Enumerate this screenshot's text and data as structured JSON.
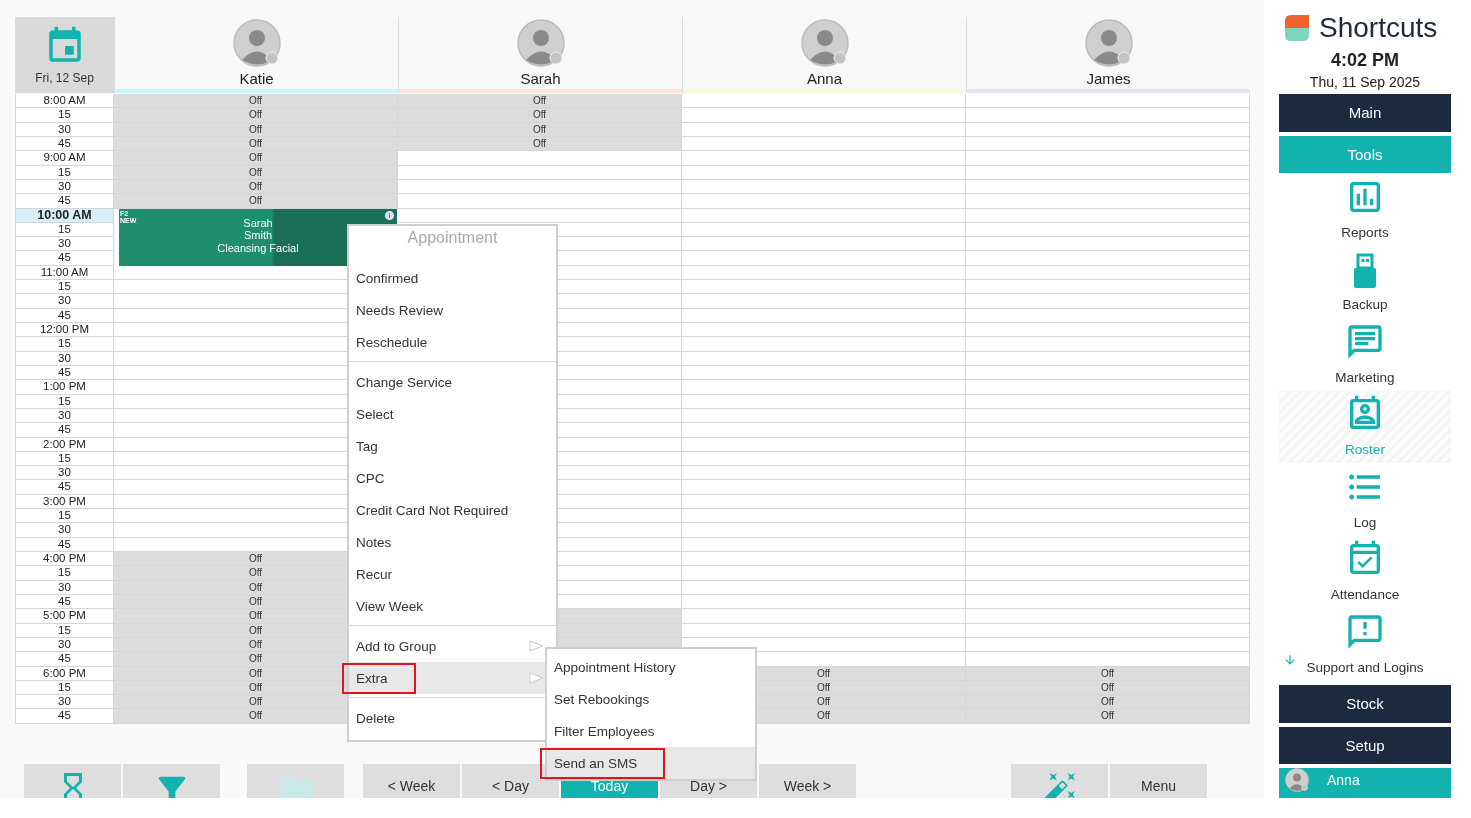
{
  "date_button": {
    "label": "Fri, 12 Sep"
  },
  "staff": [
    {
      "name": "Katie",
      "color": "#c4f6f6"
    },
    {
      "name": "Sarah",
      "color": "#fbe1dc"
    },
    {
      "name": "Anna",
      "color": "#fafad4"
    },
    {
      "name": "James",
      "color": "#e3e3f6"
    }
  ],
  "rows": [
    {
      "time": "8:00 AM",
      "selected": false,
      "cells": [
        {
          "off": true,
          "label": "Off"
        },
        {
          "off": true,
          "label": "Off"
        },
        {
          "off": false
        },
        {
          "off": false
        }
      ]
    },
    {
      "time": "15",
      "selected": false,
      "cells": [
        {
          "off": true,
          "label": "Off"
        },
        {
          "off": true,
          "label": "Off"
        },
        {
          "off": false
        },
        {
          "off": false
        }
      ]
    },
    {
      "time": "30",
      "selected": false,
      "cells": [
        {
          "off": true,
          "label": "Off"
        },
        {
          "off": true,
          "label": "Off"
        },
        {
          "off": false
        },
        {
          "off": false
        }
      ]
    },
    {
      "time": "45",
      "selected": false,
      "cells": [
        {
          "off": true,
          "label": "Off"
        },
        {
          "off": true,
          "label": "Off"
        },
        {
          "off": false
        },
        {
          "off": false
        }
      ]
    },
    {
      "time": "9:00 AM",
      "selected": false,
      "cells": [
        {
          "off": true,
          "label": "Off"
        },
        {
          "off": false
        },
        {
          "off": false
        },
        {
          "off": false
        }
      ]
    },
    {
      "time": "15",
      "selected": false,
      "cells": [
        {
          "off": true,
          "label": "Off"
        },
        {
          "off": false
        },
        {
          "off": false
        },
        {
          "off": false
        }
      ]
    },
    {
      "time": "30",
      "selected": false,
      "cells": [
        {
          "off": true,
          "label": "Off"
        },
        {
          "off": false
        },
        {
          "off": false
        },
        {
          "off": false
        }
      ]
    },
    {
      "time": "45",
      "selected": false,
      "cells": [
        {
          "off": true,
          "label": "Off"
        },
        {
          "off": false
        },
        {
          "off": false
        },
        {
          "off": false
        }
      ]
    },
    {
      "time": "10:00 AM",
      "selected": true,
      "cells": [
        {
          "booked": true,
          "appointment": {
            "tag": "F2",
            "badge": "NEW",
            "lines": [
              "Sarah",
              "Smith",
              "Cleansing Facial"
            ]
          }
        },
        {
          "off": false
        },
        {
          "off": false
        },
        {
          "off": false
        }
      ]
    },
    {
      "time": "15",
      "selected": false,
      "cells": [
        {
          "booked": true
        },
        {
          "off": false
        },
        {
          "off": false
        },
        {
          "off": false
        }
      ]
    },
    {
      "time": "30",
      "selected": false,
      "cells": [
        {
          "booked": true
        },
        {
          "off": false
        },
        {
          "off": false
        },
        {
          "off": false
        }
      ]
    },
    {
      "time": "45",
      "selected": false,
      "cells": [
        {
          "booked": true
        },
        {
          "off": false
        },
        {
          "off": false
        },
        {
          "off": false
        }
      ]
    },
    {
      "time": "11:00 AM",
      "selected": false,
      "cells": [
        {
          "off": false
        },
        {
          "off": false
        },
        {
          "off": false
        },
        {
          "off": false
        }
      ]
    },
    {
      "time": "15",
      "selected": false,
      "cells": [
        {
          "off": false
        },
        {
          "off": false
        },
        {
          "off": false
        },
        {
          "off": false
        }
      ]
    },
    {
      "time": "30",
      "selected": false,
      "cells": [
        {
          "off": false
        },
        {
          "off": false
        },
        {
          "off": false
        },
        {
          "off": false
        }
      ]
    },
    {
      "time": "45",
      "selected": false,
      "cells": [
        {
          "off": false
        },
        {
          "off": false
        },
        {
          "off": false
        },
        {
          "off": false
        }
      ]
    },
    {
      "time": "12:00 PM",
      "selected": false,
      "cells": [
        {
          "off": false
        },
        {
          "off": false
        },
        {
          "off": false
        },
        {
          "off": false
        }
      ]
    },
    {
      "time": "15",
      "selected": false,
      "cells": [
        {
          "off": false
        },
        {
          "off": false
        },
        {
          "off": false
        },
        {
          "off": false
        }
      ]
    },
    {
      "time": "30",
      "selected": false,
      "cells": [
        {
          "off": false
        },
        {
          "off": false
        },
        {
          "off": false
        },
        {
          "off": false
        }
      ]
    },
    {
      "time": "45",
      "selected": false,
      "cells": [
        {
          "off": false
        },
        {
          "off": false
        },
        {
          "off": false
        },
        {
          "off": false
        }
      ]
    },
    {
      "time": "1:00 PM",
      "selected": false,
      "cells": [
        {
          "off": false
        },
        {
          "off": false
        },
        {
          "off": false
        },
        {
          "off": false
        }
      ]
    },
    {
      "time": "15",
      "selected": false,
      "cells": [
        {
          "off": false
        },
        {
          "off": false
        },
        {
          "off": false
        },
        {
          "off": false
        }
      ]
    },
    {
      "time": "30",
      "selected": false,
      "cells": [
        {
          "off": false
        },
        {
          "off": false
        },
        {
          "off": false
        },
        {
          "off": false
        }
      ]
    },
    {
      "time": "45",
      "selected": false,
      "cells": [
        {
          "off": false
        },
        {
          "off": false
        },
        {
          "off": false
        },
        {
          "off": false
        }
      ]
    },
    {
      "time": "2:00 PM",
      "selected": false,
      "cells": [
        {
          "off": false
        },
        {
          "off": false
        },
        {
          "off": false
        },
        {
          "off": false
        }
      ]
    },
    {
      "time": "15",
      "selected": false,
      "cells": [
        {
          "off": false
        },
        {
          "off": false
        },
        {
          "off": false
        },
        {
          "off": false
        }
      ]
    },
    {
      "time": "30",
      "selected": false,
      "cells": [
        {
          "off": false
        },
        {
          "off": false
        },
        {
          "off": false
        },
        {
          "off": false
        }
      ]
    },
    {
      "time": "45",
      "selected": false,
      "cells": [
        {
          "off": false
        },
        {
          "off": false
        },
        {
          "off": false
        },
        {
          "off": false
        }
      ]
    },
    {
      "time": "3:00 PM",
      "selected": false,
      "cells": [
        {
          "off": false
        },
        {
          "off": false
        },
        {
          "off": false
        },
        {
          "off": false
        }
      ]
    },
    {
      "time": "15",
      "selected": false,
      "cells": [
        {
          "off": false
        },
        {
          "off": false
        },
        {
          "off": false
        },
        {
          "off": false
        }
      ]
    },
    {
      "time": "30",
      "selected": false,
      "cells": [
        {
          "off": false
        },
        {
          "off": false
        },
        {
          "off": false
        },
        {
          "off": false
        }
      ]
    },
    {
      "time": "45",
      "selected": false,
      "cells": [
        {
          "off": false
        },
        {
          "off": false
        },
        {
          "off": false
        },
        {
          "off": false
        }
      ]
    },
    {
      "time": "4:00 PM",
      "selected": false,
      "cells": [
        {
          "off": true,
          "label": "Off"
        },
        {
          "off": false
        },
        {
          "off": false
        },
        {
          "off": false
        }
      ]
    },
    {
      "time": "15",
      "selected": false,
      "cells": [
        {
          "off": true,
          "label": "Off"
        },
        {
          "off": false
        },
        {
          "off": false
        },
        {
          "off": false
        }
      ]
    },
    {
      "time": "30",
      "selected": false,
      "cells": [
        {
          "off": true,
          "label": "Off"
        },
        {
          "off": false
        },
        {
          "off": false
        },
        {
          "off": false
        }
      ]
    },
    {
      "time": "45",
      "selected": false,
      "cells": [
        {
          "off": true,
          "label": "Off"
        },
        {
          "off": false
        },
        {
          "off": false
        },
        {
          "off": false
        }
      ]
    },
    {
      "time": "5:00 PM",
      "selected": false,
      "cells": [
        {
          "off": true,
          "label": "Off"
        },
        {
          "off": true
        },
        {
          "off": false
        },
        {
          "off": false
        }
      ]
    },
    {
      "time": "15",
      "selected": false,
      "cells": [
        {
          "off": true,
          "label": "Off"
        },
        {
          "off": true
        },
        {
          "off": false
        },
        {
          "off": false
        }
      ]
    },
    {
      "time": "30",
      "selected": false,
      "cells": [
        {
          "off": true,
          "label": "Off"
        },
        {
          "off": true
        },
        {
          "off": false
        },
        {
          "off": false
        }
      ]
    },
    {
      "time": "45",
      "selected": false,
      "cells": [
        {
          "off": true,
          "label": "Off"
        },
        {},
        {
          "off": false
        },
        {
          "off": false
        }
      ]
    },
    {
      "time": "6:00 PM",
      "selected": false,
      "cells": [
        {
          "off": true,
          "label": "Off"
        },
        {},
        {
          "off": true,
          "label": "Off"
        },
        {
          "off": true,
          "label": "Off"
        }
      ]
    },
    {
      "time": "15",
      "selected": false,
      "cells": [
        {
          "off": true,
          "label": "Off"
        },
        {},
        {
          "off": true,
          "label": "Off"
        },
        {
          "off": true,
          "label": "Off"
        }
      ]
    },
    {
      "time": "30",
      "selected": false,
      "cells": [
        {
          "off": true,
          "label": "Off"
        },
        {},
        {
          "off": true,
          "label": "Off"
        },
        {
          "off": true,
          "label": "Off"
        }
      ]
    },
    {
      "time": "45",
      "selected": false,
      "cells": [
        {
          "off": true,
          "label": "Off"
        },
        {},
        {
          "off": true,
          "label": "Off"
        },
        {
          "off": true,
          "label": "Off"
        }
      ]
    }
  ],
  "context_menu": {
    "title": "Appointment",
    "groups": [
      [
        {
          "label": "Confirmed",
          "selected": false,
          "marked": false,
          "has_submenu": false
        },
        {
          "label": "Needs Review",
          "selected": false,
          "marked": false,
          "has_submenu": false
        },
        {
          "label": "Reschedule",
          "selected": false,
          "marked": false,
          "has_submenu": false
        }
      ],
      [
        {
          "label": "Change Service",
          "selected": false,
          "marked": false,
          "has_submenu": false
        },
        {
          "label": "Select",
          "selected": false,
          "marked": false,
          "has_submenu": false
        },
        {
          "label": "Tag",
          "selected": false,
          "marked": false,
          "has_submenu": false
        },
        {
          "label": "CPC",
          "selected": false,
          "marked": false,
          "has_submenu": false
        },
        {
          "label": "Credit Card Not Required",
          "selected": false,
          "marked": false,
          "has_submenu": false
        },
        {
          "label": "Notes",
          "selected": false,
          "marked": false,
          "has_submenu": false
        },
        {
          "label": "Recur",
          "selected": false,
          "marked": false,
          "has_submenu": false
        },
        {
          "label": "View Week",
          "selected": false,
          "marked": false,
          "has_submenu": false
        }
      ],
      [
        {
          "label": "Add to Group",
          "selected": false,
          "marked": false,
          "has_submenu": true
        },
        {
          "label": "Extra",
          "selected": true,
          "marked": true,
          "has_submenu": true
        }
      ],
      [
        {
          "label": "Delete",
          "selected": false,
          "marked": false,
          "has_submenu": false
        }
      ]
    ]
  },
  "submenu": {
    "items": [
      {
        "label": "Appointment History",
        "selected": false,
        "marked": false
      },
      {
        "label": "Set Rebookings",
        "selected": false,
        "marked": false
      },
      {
        "label": "Filter Employees",
        "selected": false,
        "marked": false
      },
      {
        "label": "Send an SMS",
        "selected": true,
        "marked": true
      }
    ]
  },
  "toolbar": [
    [
      {
        "kind": "icon",
        "selected": false,
        "disabled": false
      },
      {
        "kind": "icon",
        "selected": false,
        "disabled": false
      }
    ],
    [
      {
        "kind": "icon",
        "selected": false,
        "disabled": true
      }
    ],
    [
      {
        "kind": "text",
        "label": "< Week",
        "selected": false,
        "disabled": false
      },
      {
        "kind": "text",
        "label": "< Day",
        "selected": false,
        "disabled": false
      },
      {
        "kind": "text",
        "label": "Today",
        "selected": true,
        "disabled": false
      },
      {
        "kind": "text",
        "label": "Day >",
        "selected": false,
        "disabled": false
      },
      {
        "kind": "text",
        "label": "Week >",
        "selected": false,
        "disabled": false
      }
    ],
    [
      {
        "kind": "icon",
        "selected": false,
        "disabled": false
      },
      {
        "kind": "text",
        "label": "Menu",
        "selected": false,
        "disabled": false
      }
    ]
  ],
  "sidebar": {
    "title": "Shortcuts",
    "time": "4:02 PM",
    "date": "Thu, 11 Sep 2025",
    "sections": [
      {
        "label": "Main",
        "expanded": false
      },
      {
        "label": "Tools",
        "expanded": true
      }
    ],
    "tools": [
      {
        "label": "Reports",
        "selected": false
      },
      {
        "label": "Backup",
        "selected": false
      },
      {
        "label": "Marketing",
        "selected": false
      },
      {
        "label": "Roster",
        "selected": true
      },
      {
        "label": "Log",
        "selected": false
      },
      {
        "label": "Attendance",
        "selected": false
      },
      {
        "label": "Support and Logins",
        "selected": false
      }
    ],
    "more_sections": [
      {
        "label": "Stock",
        "expanded": false
      },
      {
        "label": "Setup",
        "expanded": false
      }
    ],
    "user": {
      "name": "Anna"
    }
  }
}
